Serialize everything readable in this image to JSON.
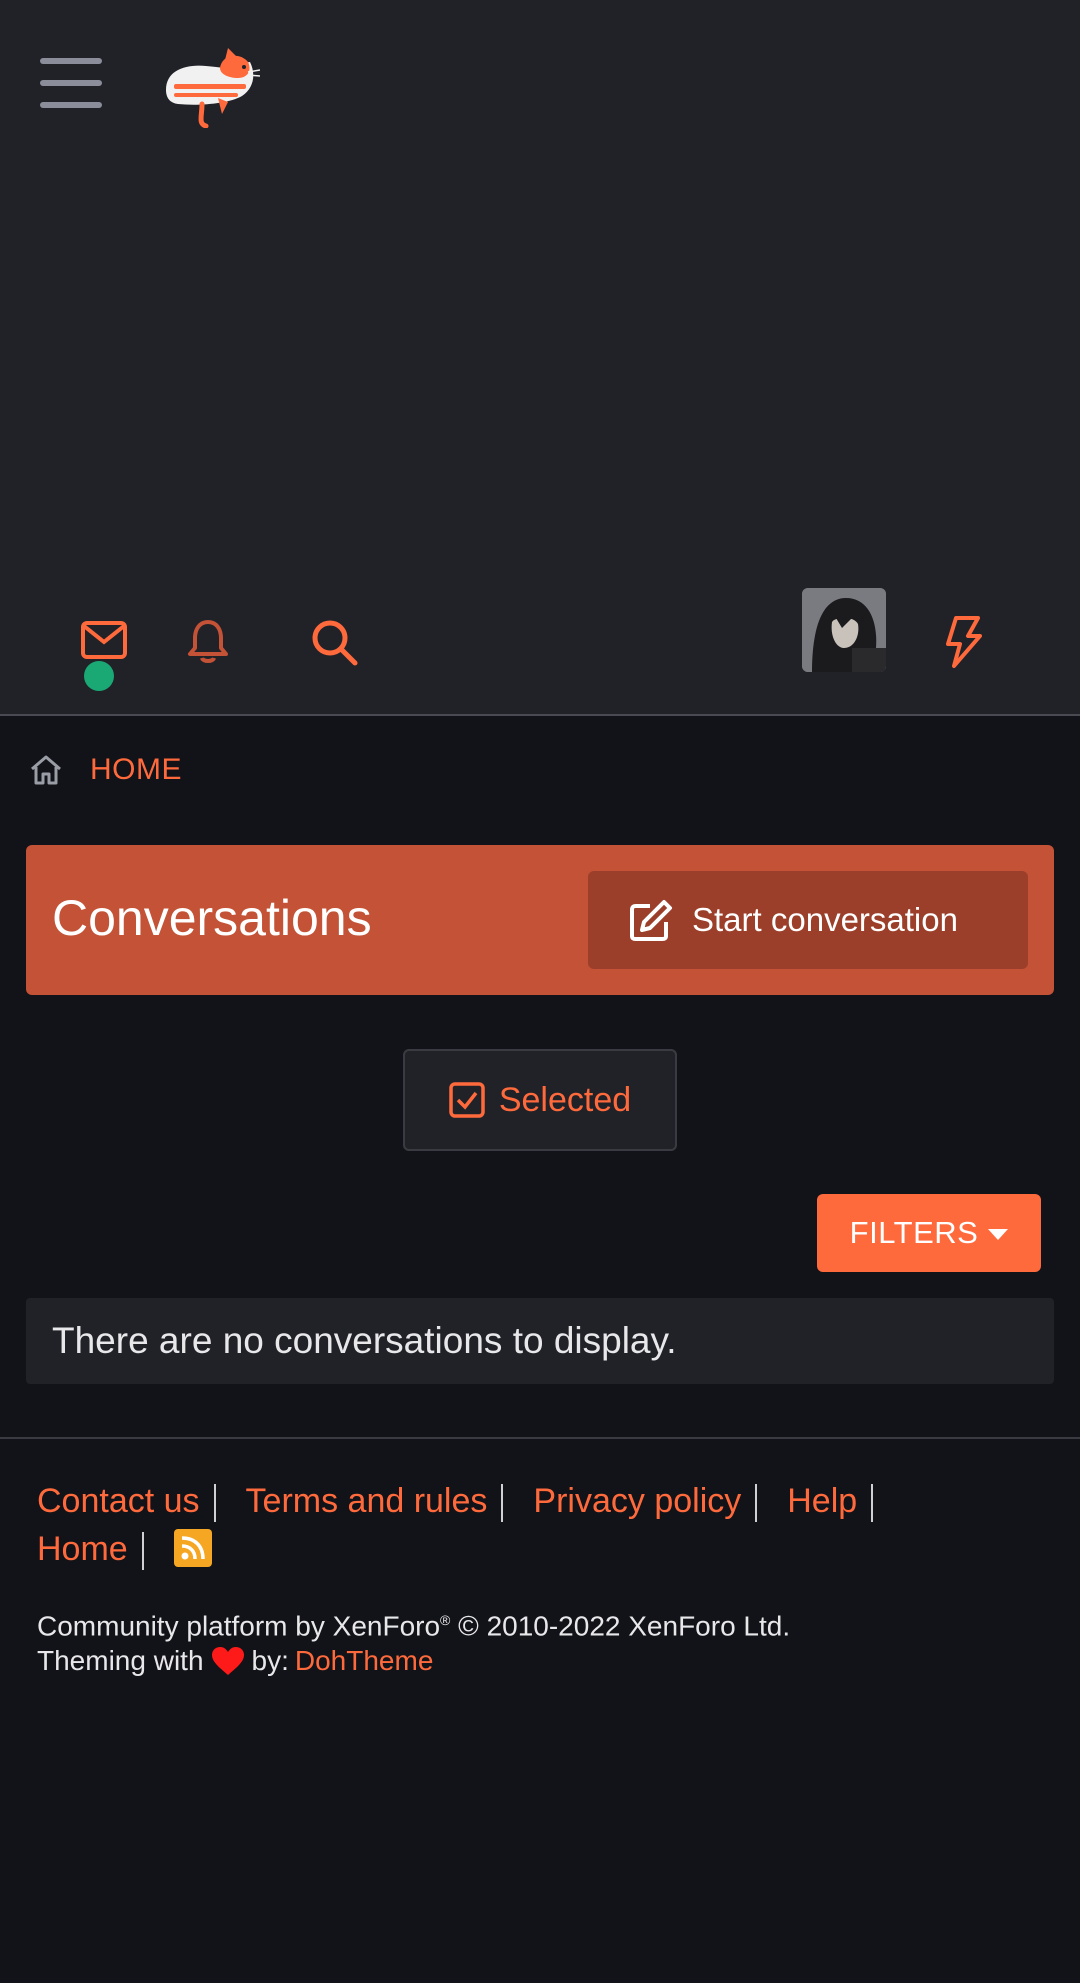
{
  "header": {
    "menu_icon": "hamburger-menu-icon",
    "logo": "cat-logo",
    "icons": [
      "mail-icon",
      "bell-icon",
      "search-icon",
      "user-avatar",
      "bolt-icon"
    ],
    "status_color": "#1aa874"
  },
  "breadcrumb": {
    "icon": "home-icon",
    "label": "HOME"
  },
  "page": {
    "title": "Conversations",
    "start_button_label": "Start conversation",
    "selected_label": "Selected",
    "filters_label": "FILTERS",
    "empty_message": "There are no conversations to display."
  },
  "footer": {
    "links": {
      "contact": "Contact us",
      "terms": "Terms and rules",
      "privacy": "Privacy policy",
      "help": "Help",
      "home": "Home"
    },
    "rss_icon": "rss-icon",
    "copyright_prefix": "Community platform by XenForo",
    "copyright_mark": "®",
    "copyright_suffix": " © 2010-2022 XenForo Ltd.",
    "theming_prefix": "Theming with",
    "theming_by": "by:",
    "theme_link": "DohTheme"
  },
  "colors": {
    "accent": "#ff6a3d",
    "title_bar": "#c35236",
    "header_bg": "#212228",
    "page_bg": "#121318"
  }
}
